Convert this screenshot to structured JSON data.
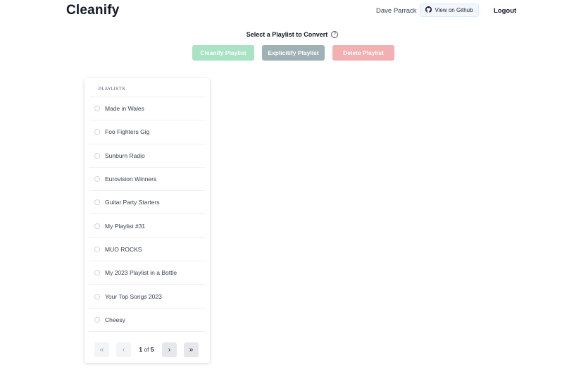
{
  "header": {
    "app_title": "Cleanify",
    "user_name": "Dave Parrack",
    "github_label": "View on Github",
    "logout_label": "Logout"
  },
  "toolbar": {
    "select_label": "Select a Playlist to Convert",
    "help_icon": "question-circle-icon",
    "cleanify_label": "Cleanify Playlist",
    "explicitify_label": "Explicitify Playlist",
    "delete_label": "Delete Playlist",
    "colors": {
      "cleanify": "#a9e2c4",
      "explicitify": "#9fb1b5",
      "delete": "#f3b0b2"
    }
  },
  "playlists": {
    "header": "PLAYLISTS",
    "items": [
      {
        "name": "Made in Wales"
      },
      {
        "name": "Foo Fighters Gig"
      },
      {
        "name": "Sunburn Radio"
      },
      {
        "name": "Eurovision Winners"
      },
      {
        "name": "Guitar Party Starters"
      },
      {
        "name": "My Playlist #31"
      },
      {
        "name": "MUO ROCKS"
      },
      {
        "name": "My 2023 Playlist in a Bottle"
      },
      {
        "name": "Your Top Songs 2023"
      },
      {
        "name": "Cheesy"
      }
    ],
    "pagination": {
      "current_page": "1",
      "of_label": "of",
      "total_pages": "5",
      "first_icon": "double-chevron-left-icon",
      "prev_icon": "chevron-left-icon",
      "next_icon": "chevron-right-icon",
      "last_icon": "double-chevron-right-icon"
    }
  }
}
